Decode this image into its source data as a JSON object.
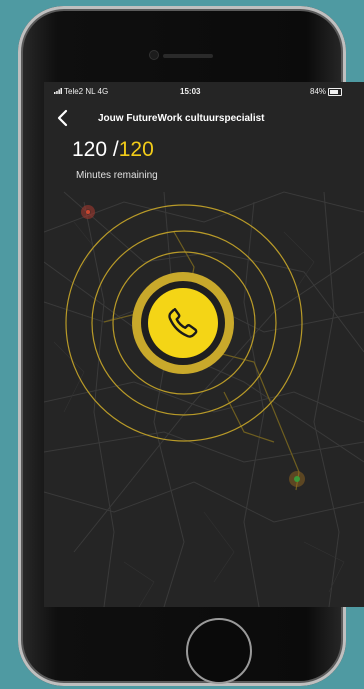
{
  "status_bar": {
    "carrier": "Tele2 NL  4G",
    "time": "15:03",
    "battery": "84%",
    "battery_level": 0.84
  },
  "header": {
    "back_icon": "chevron-left-icon",
    "title": "Jouw FutureWork cultuurspecialist"
  },
  "minutes": {
    "remaining": "120",
    "separator": " /",
    "total": "120",
    "label": "Minutes remaining"
  },
  "call": {
    "icon": "phone-icon"
  },
  "colors": {
    "accent": "#f4d516",
    "ring": "#c9a92b",
    "map_bg": "#252525",
    "page_bg": "#4f9aa2",
    "pin_red": "#b43a2e",
    "pin_green": "#3a9a3a"
  }
}
